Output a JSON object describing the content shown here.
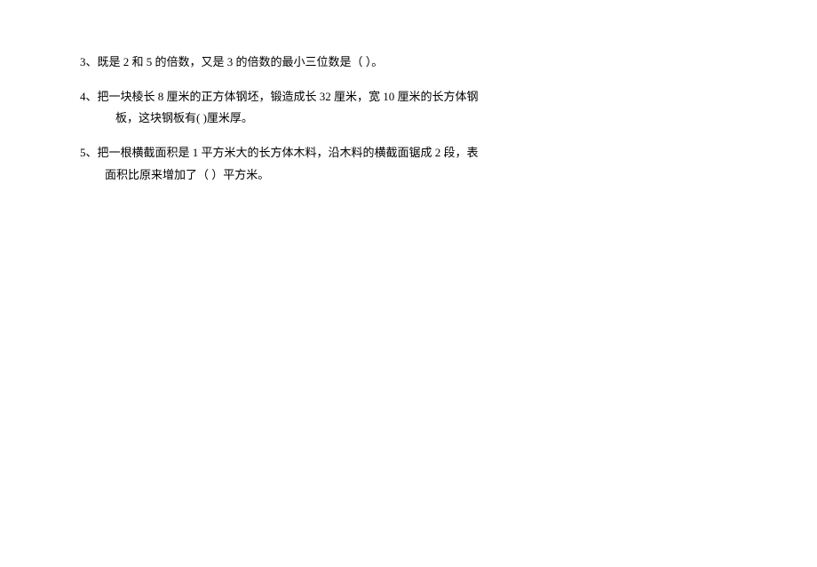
{
  "questions": [
    {
      "number": "3、",
      "line1": "既是 2 和 5 的倍数，又是 3 的倍数的最小三位数是（          ）。"
    },
    {
      "number": "4、",
      "line1": "把一块棱长 8 厘米的正方体钢坯，锻造成长 32 厘米，宽 10 厘米的长方体钢",
      "line2": "板，这块钢板有(            )厘米厚。"
    },
    {
      "number": "5、",
      "line1": "把一根横截面积是 1 平方米大的长方体木料，沿木料的横截面锯成 2 段，表",
      "line2": "面积比原来增加了（      ）平方米。"
    }
  ]
}
